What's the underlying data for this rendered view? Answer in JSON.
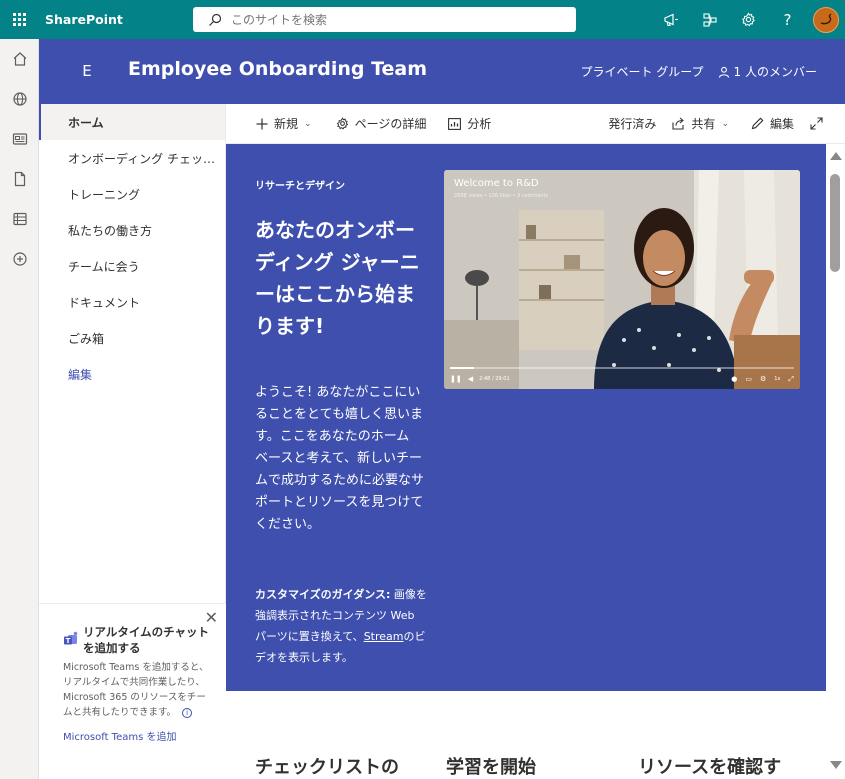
{
  "suite": {
    "brand": "SharePoint",
    "search_placeholder": "このサイトを検索",
    "icons": [
      "waffle-icon",
      "megaphone-icon",
      "network-icon",
      "gear-icon",
      "help-icon",
      "avatar"
    ]
  },
  "site": {
    "logo_letter": "E",
    "title": "Employee Onboarding Team",
    "privacy": "プライベート グループ",
    "members": "1 人のメンバー",
    "header_color": "#3f4fad",
    "suite_color": "#038387"
  },
  "nav": {
    "items": [
      {
        "label": "ホーム",
        "selected": true
      },
      {
        "label": "オンボーディング チェッ…"
      },
      {
        "label": "トレーニング"
      },
      {
        "label": "私たちの働き方"
      },
      {
        "label": "チームに会う"
      },
      {
        "label": "ドキュメント"
      },
      {
        "label": "ごみ箱"
      }
    ],
    "edit_label": "編集"
  },
  "promo": {
    "title": "リアルタイムのチャットを追加する",
    "body": "Microsoft Teams を追加すると、リアルタイムで共同作業したり、Microsoft 365 のリソースをチームと共有したりできます。",
    "link": "Microsoft Teams を追加"
  },
  "commands": {
    "new": "新規",
    "page_details": "ページの詳細",
    "analytics": "分析",
    "published": "発行済み",
    "share": "共有",
    "edit": "編集"
  },
  "hero": {
    "eyebrow": "リサーチとデザイン",
    "title": "あなたのオンボーディング ジャーニーはここから始まります!",
    "body": "ようこそ! あなたがここにいることをとても嬉しく思います。ここをあなたのホーム ベースと考えて、新しいチームで成功するために必要なサポートとリソースを見つけてください。",
    "note_bold": "カスタマイズのガイダンス:",
    "note_text": " 画像を強調表示されたコンテンツ Web パーツに置き換えて、",
    "note_link": "Stream",
    "note_tail": "のビデオを表示します。"
  },
  "video": {
    "title": "Welcome to R&D",
    "meta": "2888 views • 136 likes • 3 comments",
    "time": "2:48 / 29:01",
    "speed": "1x",
    "progress": 0.07
  },
  "sections": {
    "checklist": "チェックリストの",
    "learning": "学習を開始",
    "resources": "リソースを確認す"
  }
}
